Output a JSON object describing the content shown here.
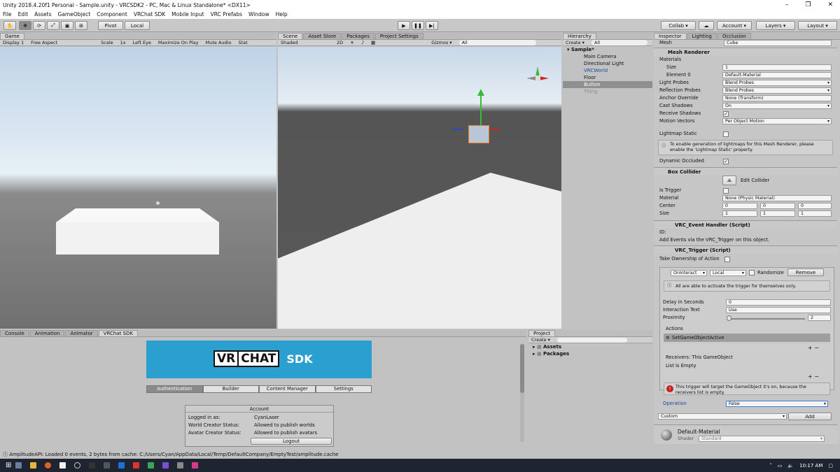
{
  "window": {
    "title": "Unity 2018.4.20f1 Personal - Sample.unity - VRCSDK2 - PC, Mac & Linux Standalone* <DX11>"
  },
  "menu": [
    "File",
    "Edit",
    "Assets",
    "GameObject",
    "Component",
    "VRChat SDK",
    "Mobile Input",
    "VRC Prefabs",
    "Window",
    "Help"
  ],
  "toolbar": {
    "pivot": "Pivot",
    "local": "Local",
    "collab": "Collab ▾",
    "account": "Account ▾",
    "layers": "Layers ▾",
    "layout": "Layout ▾"
  },
  "game": {
    "tab": "Game",
    "display": "Display 1",
    "aspect": "Free Aspect",
    "scale_label": "Scale",
    "scale_value": "1x",
    "eye": "Left Eye",
    "maximize": "Maximize On Play",
    "mute": "Mute Audio",
    "stats": "Stat"
  },
  "scene": {
    "tabs": [
      "Scene",
      "Asset Store",
      "Packages",
      "Project Settings"
    ],
    "shading": "Shaded",
    "mode": "2D",
    "gizmos": "Gizmos ▾",
    "search": "All"
  },
  "hierarchy": {
    "tab": "Hierarchy",
    "create": "Create ▾",
    "search": "All",
    "scene": "Sample*",
    "items": [
      {
        "label": "Main Camera",
        "style": "normal"
      },
      {
        "label": "Directional Light",
        "style": "normal"
      },
      {
        "label": "VRCWorld",
        "style": "prefab"
      },
      {
        "label": "Floor",
        "style": "normal"
      },
      {
        "label": "Button",
        "style": "selected"
      },
      {
        "label": "Thing",
        "style": "disabled"
      }
    ]
  },
  "inspector": {
    "tabs": [
      "Inspector",
      "Lighting",
      "Occlusion"
    ],
    "mesh_label": "Mesh",
    "mesh_value": "Cube",
    "mesh_renderer": {
      "title": "Mesh Renderer",
      "materials": "Materials",
      "size_label": "Size",
      "size_value": "1",
      "element_label": "Element 0",
      "element_value": "Default-Material",
      "light_probes_label": "Light Probes",
      "light_probes_value": "Blend Probes",
      "reflection_probes_label": "Reflection Probes",
      "reflection_probes_value": "Blend Probes",
      "anchor_label": "Anchor Override",
      "anchor_value": "None (Transform)",
      "cast_label": "Cast Shadows",
      "cast_value": "On",
      "receive_label": "Receive Shadows",
      "motion_label": "Motion Vectors",
      "motion_value": "Per Object Motion",
      "lightmap_label": "Lightmap Static",
      "lightmap_info": "To enable generation of lightmaps for this Mesh Renderer, please enable the 'Lightmap Static' property.",
      "occluded_label": "Dynamic Occluded"
    },
    "box_collider": {
      "title": "Box Collider",
      "edit": "Edit Collider",
      "trigger_label": "Is Trigger",
      "material_label": "Material",
      "material_value": "None (Physic Material)",
      "center_label": "Center",
      "center": [
        "0",
        "0",
        "0"
      ],
      "size_label": "Size",
      "size": [
        "1",
        "1",
        "1"
      ]
    },
    "event_handler": {
      "title": "VRC_Event Handler (Script)",
      "id_label": "ID:",
      "note": "Add Events via the VRC_Trigger on this object."
    },
    "trigger": {
      "title": "VRC_Trigger (Script)",
      "ownership_label": "Take Ownership of Action",
      "type": "OnInteract",
      "broadcast": "Local",
      "randomize": "Randomize",
      "remove": "Remove",
      "info": "All are able to activate the trigger for themselves only.",
      "delay_label": "Delay in Seconds",
      "delay_value": "0",
      "interaction_label": "Interaction Text",
      "interaction_value": "Use",
      "proximity_label": "Proximity",
      "proximity_value": "2",
      "actions_label": "Actions",
      "action_item": "SetGameObjectActive",
      "receivers_label": "Receivers: This GameObject",
      "list_empty": "List is Empty",
      "warning": "This trigger will target the GameObject it's on, because the receivers list is empty.",
      "operation_label": "Operation",
      "operation_value": "False",
      "custom": "Custom",
      "add": "Add"
    },
    "material": {
      "name": "Default-Material",
      "shader_label": "Shader",
      "shader_value": "Standard"
    }
  },
  "bottom": {
    "tabs": [
      "Console",
      "Animation",
      "Animator",
      "VRChat SDK"
    ],
    "logo_left": "VR",
    "logo_mid": "CHAT",
    "logo_right": "SDK",
    "sdk_tabs": [
      "Authentication",
      "Builder",
      "Content Manager",
      "Settings"
    ],
    "account": {
      "title": "Account",
      "logged_label": "Logged in as:",
      "logged_value": "CyanLaser",
      "world_label": "World Creator Status:",
      "world_value": "Allowed to publish worlds",
      "avatar_label": "Avatar Creator Status:",
      "avatar_value": "Allowed to publish avatars",
      "logout": "Logout"
    }
  },
  "project": {
    "tab": "Project",
    "create": "Create ▾",
    "items": [
      "Assets",
      "Packages"
    ]
  },
  "status": "AmplitudeAPI: Loaded 0 events, 2 bytes from cache: C:/Users/Cyan/AppData/Local/Temp/DefaultCompany/EmptyTest/amplitude.cache",
  "taskbar": {
    "time": "10:17 AM"
  },
  "colors": {
    "accent": "#3d7bd6",
    "sdk_blue": "#2a9fd0",
    "selected": "#3d6fb6"
  }
}
